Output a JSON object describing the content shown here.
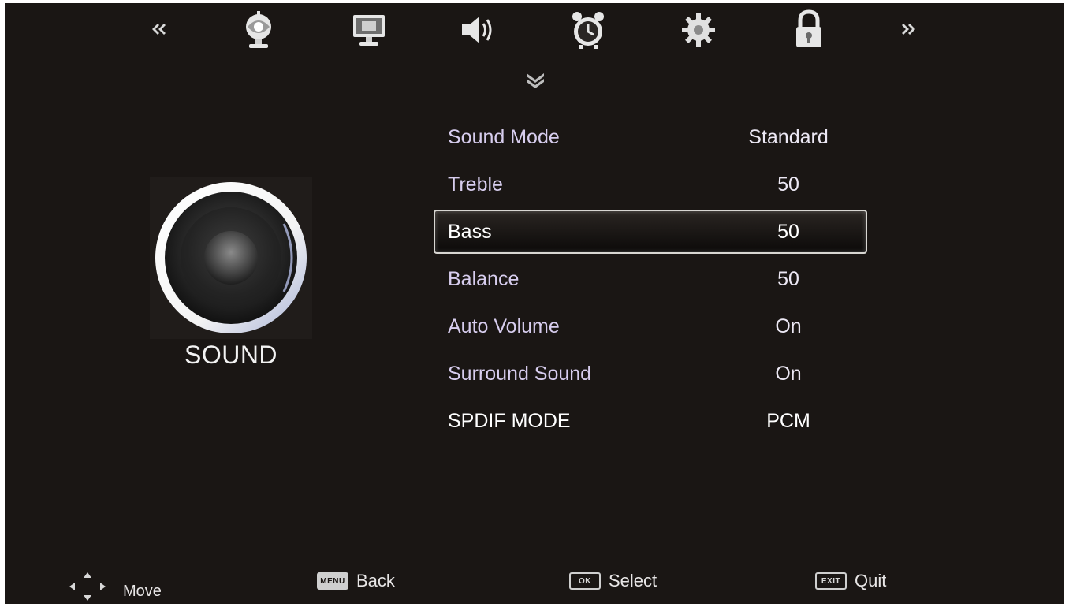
{
  "topbar": {
    "icons": [
      {
        "name": "picture-icon"
      },
      {
        "name": "display-icon"
      },
      {
        "name": "sound-icon"
      },
      {
        "name": "timer-icon"
      },
      {
        "name": "setup-icon"
      },
      {
        "name": "lock-icon"
      }
    ],
    "active": "sound-icon"
  },
  "category": {
    "label": "SOUND",
    "icon": "speaker-icon"
  },
  "menu": {
    "items": [
      {
        "label": "Sound Mode",
        "value": "Standard"
      },
      {
        "label": "Treble",
        "value": "50"
      },
      {
        "label": "Bass",
        "value": "50"
      },
      {
        "label": "Balance",
        "value": "50"
      },
      {
        "label": "Auto Volume",
        "value": "On"
      },
      {
        "label": "Surround Sound",
        "value": "On"
      },
      {
        "label": "SPDIF MODE",
        "value": "PCM"
      }
    ],
    "selected": "Bass"
  },
  "help": {
    "move": "Move",
    "back_key": "MENU",
    "back": "Back",
    "select_key": "OK",
    "select": "Select",
    "quit_key": "EXIT",
    "quit": "Quit"
  },
  "colors": {
    "background": "#1a1614",
    "label_text": "#d7cdee",
    "highlight_border": "#d8d6d2"
  }
}
